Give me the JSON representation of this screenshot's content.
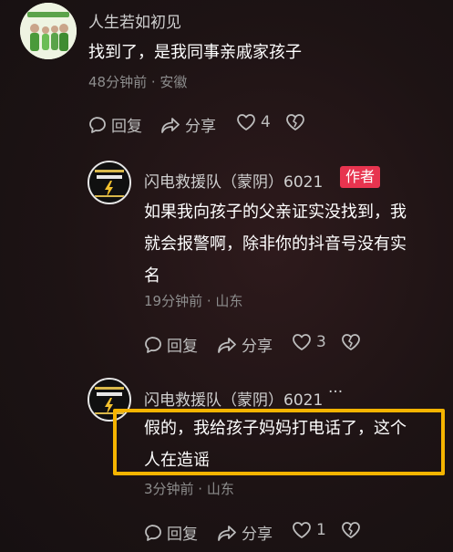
{
  "comments": [
    {
      "username": "人生若如初见",
      "text": "找到了，是我同事亲戚家孩子",
      "meta": "48分钟前 · 安徽",
      "reply_label": "回复",
      "share_label": "分享",
      "like_count": "4",
      "avatar_icon": "family-photo-avatar"
    },
    {
      "username": "闪电救援队（蒙阴）6021",
      "badge": "作者",
      "text_lines": [
        "如果我向孩子的父亲证实没找到，我",
        "就会报警啊，除非你的抖音号没有实",
        "名"
      ],
      "meta": "19分钟前 · 山东",
      "reply_label": "回复",
      "share_label": "分享",
      "like_count": "3",
      "avatar_icon": "lightning-rescue-avatar"
    },
    {
      "username": "闪电救援队（蒙阴）6021",
      "more": "···",
      "text_lines": [
        "假的，我给孩子妈妈打电话了，这个",
        "人在造谣"
      ],
      "meta": "3分钟前 · 山东",
      "reply_label": "回复",
      "share_label": "分享",
      "like_count": "1",
      "avatar_icon": "lightning-rescue-avatar"
    }
  ],
  "colors": {
    "background": "#1d1314",
    "author_badge": "#e7344f",
    "highlight_border": "#f5b400",
    "meta_text": "#8d8d8d"
  }
}
